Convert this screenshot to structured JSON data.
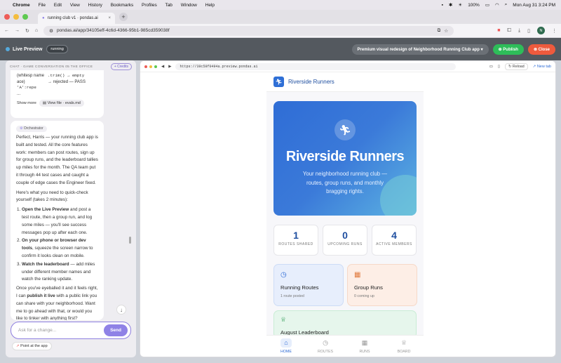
{
  "macos": {
    "app": "Chrome",
    "menu": [
      "File",
      "Edit",
      "View",
      "History",
      "Bookmarks",
      "Profiles",
      "Tab",
      "Window",
      "Help"
    ],
    "battery": "100%",
    "clock": "Mon Aug 31  3:24 PM"
  },
  "browser": {
    "tab_title": "running club v1 · pondas.ai",
    "url": "pondas.ai/app/34105eff-4c6d-4366-95b1-985cd359038f",
    "profile_initial": "N"
  },
  "apptop": {
    "live_preview": "Live Preview",
    "status": "running",
    "task": "Premium visual redesign of Neighborhood Running Club app",
    "publish": "Publish",
    "close": "Close"
  },
  "chat": {
    "header": "CHAT · GAME CONVERSATION 05 THE OFFICE",
    "credits": "+ Credits",
    "snippet": {
      "left_lines": [
        "(whitesp  name",
        "ace)",
        "'A':repe",
        "..."
      ],
      "right_lines": [
        ".trim() → empty",
        "→ rejected — PASS"
      ],
      "show_more": "Show more",
      "view_file": "View file · evals.md"
    },
    "message": {
      "author": "Orchestrator",
      "intro": "Perfect, Harris — your running club app is built and tested. All the core features work: members can post routes, sign up for group runs, and the leaderboard tallies up miles for the month. The QA team put it through 44 test cases and caught a couple of edge cases the Engineer fixed.",
      "lead": "Here's what you need to quick-check yourself (takes 2 minutes):",
      "steps": [
        {
          "bold": "Open the Live Preview",
          "text": " and post a test route, then a group run, and log some miles — you'll see success messages pop up after each one."
        },
        {
          "bold": "On your phone or browser dev tools",
          "text": ", squeeze the screen narrow to confirm it looks clean on mobile."
        },
        {
          "bold": "Watch the leaderboard",
          "text": " — add miles under different member names and watch the ranking update."
        }
      ],
      "outro_a": "Once you've eyeballed it and it feels right, I can ",
      "outro_bold": "publish it live",
      "outro_b": " with a public link you can share with your neighborhood. Want me to go ahead with that, or would you like to tinker with anything first?"
    },
    "input_placeholder": "Ask for a change...",
    "send": "Send",
    "point": "Point at the app"
  },
  "preview": {
    "url": "https://39c59f0494a.preview.pondas.ai",
    "reload": "Reload",
    "new_tab": "New tab",
    "app": {
      "brand": "Riverside Runners",
      "hero_title": "Riverside Runners",
      "hero_sub": "Your neighborhood running club — routes, group runs, and monthly bragging rights.",
      "stats": [
        {
          "value": "1",
          "label": "ROUTES SHARED"
        },
        {
          "value": "0",
          "label": "UPCOMING RUNS"
        },
        {
          "value": "4",
          "label": "ACTIVE MEMBERS"
        }
      ],
      "features": [
        {
          "title": "Running Routes",
          "sub": "1 route posted"
        },
        {
          "title": "Group Runs",
          "sub": "0 coming up"
        },
        {
          "title": "August Leaderboard",
          "sub": ""
        }
      ],
      "nav": [
        "HOME",
        "ROUTES",
        "RUNS",
        "BOARD"
      ]
    }
  }
}
